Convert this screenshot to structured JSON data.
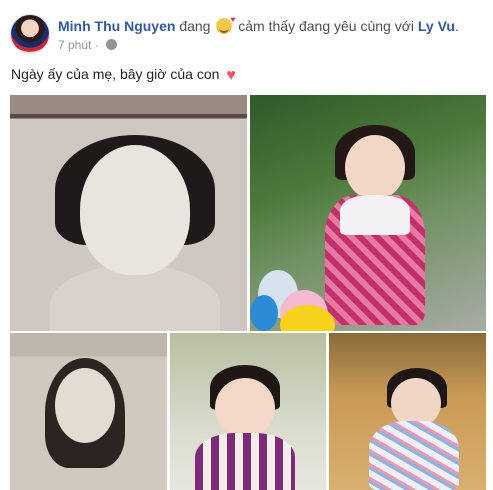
{
  "post": {
    "author": "Minh Thu Nguyen",
    "feeling_prefix": "đang",
    "feeling_text": "cảm thấy đang yêu cùng với",
    "tagged_friend": "Ly Vu",
    "tagged_suffix": ".",
    "timestamp": "7 phút",
    "separator": "·",
    "caption": "Ngày ấy của mẹ, bây giờ của con",
    "caption_emoji": "♥",
    "icons": {
      "avatar": "profile-avatar",
      "feeling": "in-love-emoji",
      "privacy": "globe-icon",
      "heart": "heart-emoji"
    },
    "colors": {
      "link": "#365899",
      "meta": "#90949c",
      "heart": "#f25268"
    },
    "photos_count_shown": 5
  }
}
